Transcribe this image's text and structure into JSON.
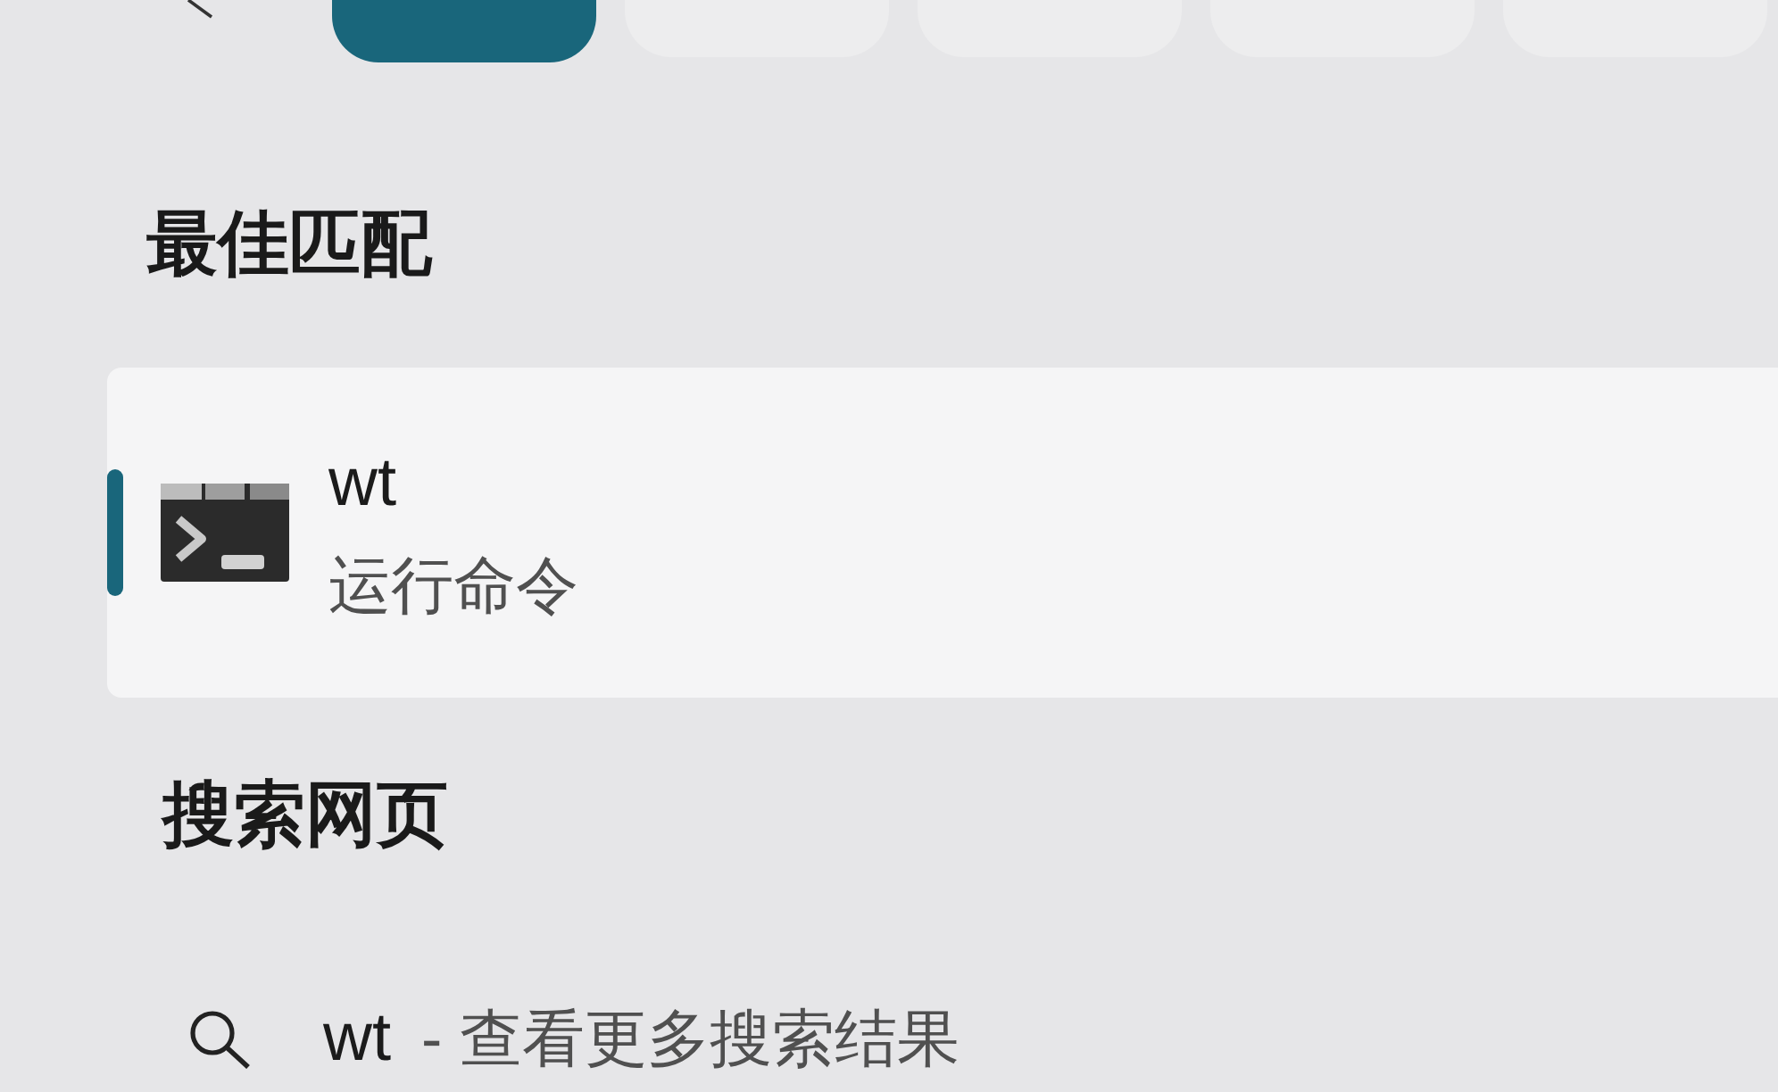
{
  "nav": {
    "tabs": [
      {
        "selected": true
      },
      {
        "selected": false
      },
      {
        "selected": false
      },
      {
        "selected": false
      },
      {
        "selected": false
      }
    ]
  },
  "best_match": {
    "heading": "最佳匹配",
    "result": {
      "title": "wt",
      "subtitle": "运行命令",
      "selected": true
    }
  },
  "web_search": {
    "heading": "搜索网页",
    "results": [
      {
        "query": "wt",
        "text": "- 查看更多搜索结果"
      }
    ]
  }
}
